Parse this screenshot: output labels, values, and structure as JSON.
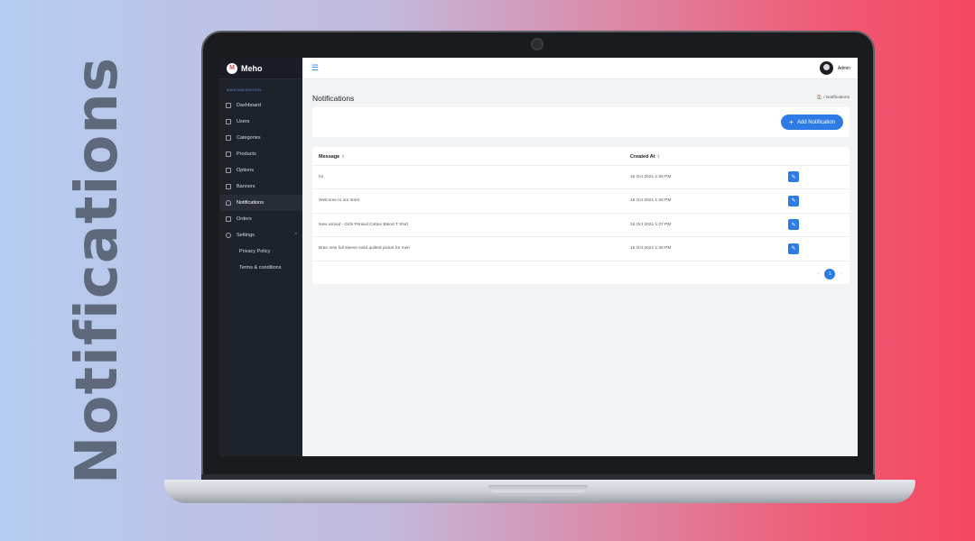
{
  "promo": {
    "title": "Notifications"
  },
  "app": {
    "brand": "Meho",
    "brand_initial": "M"
  },
  "sidebar": {
    "heading": "MAIN NAVIGATION",
    "items": [
      {
        "label": "Dashboard",
        "icon": "home-icon"
      },
      {
        "label": "Users",
        "icon": "users-icon"
      },
      {
        "label": "Categories",
        "icon": "categories-icon"
      },
      {
        "label": "Products",
        "icon": "products-icon"
      },
      {
        "label": "Options",
        "icon": "options-icon"
      },
      {
        "label": "Banners",
        "icon": "banners-icon"
      },
      {
        "label": "Notifications",
        "icon": "bell-icon",
        "active": true
      },
      {
        "label": "Orders",
        "icon": "orders-icon"
      },
      {
        "label": "Settings",
        "icon": "gear-icon",
        "expanded": true
      }
    ],
    "sub_items": [
      {
        "label": "Privacy Policy"
      },
      {
        "label": "Terms & conditions"
      }
    ]
  },
  "header": {
    "menu_icon": "hamburger-icon",
    "user_name": "Admin"
  },
  "page": {
    "title": "Notifications",
    "breadcrumb": "🏠 / Notifications",
    "add_button": "Add Notification"
  },
  "table": {
    "columns": [
      "Message",
      "Created At"
    ],
    "rows": [
      {
        "message": "hii",
        "created_at": "16 Oct 2021 1:26 PM"
      },
      {
        "message": "Welcome to our store",
        "created_at": "16 Oct 2021 1:26 PM"
      },
      {
        "message": "New arrival - Girls Printed Cotton Blend T Shirt",
        "created_at": "16 Oct 2021 1:27 PM"
      },
      {
        "message": "Bran new full sleeve solid quilted jacket for men",
        "created_at": "16 Oct 2021 1:28 PM"
      }
    ]
  },
  "pagination": {
    "prev": "‹",
    "current": "1",
    "next": "›"
  },
  "colors": {
    "accent": "#2f7be6",
    "sidebar_bg": "#1e222b",
    "promo_text": "#5e6a7c"
  }
}
